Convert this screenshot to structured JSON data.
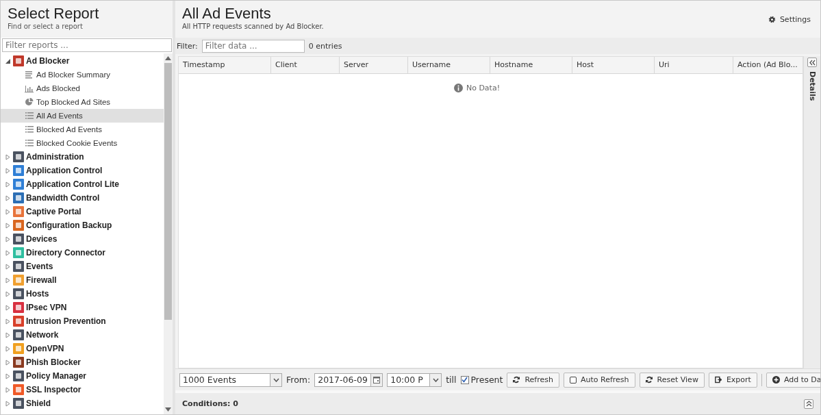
{
  "sidebar": {
    "title": "Select Report",
    "subtitle": "Find or select a report",
    "filter": {
      "placeholder": "Filter reports ..."
    },
    "items": [
      {
        "label": "Ad Blocker",
        "expanded": true,
        "color": "#c0392b",
        "children": [
          {
            "label": "Ad Blocker Summary",
            "kind": "summary",
            "selected": false
          },
          {
            "label": "Ads Blocked",
            "kind": "bar",
            "selected": false
          },
          {
            "label": "Top Blocked Ad Sites",
            "kind": "pie",
            "selected": false
          },
          {
            "label": "All Ad Events",
            "kind": "list",
            "selected": true
          },
          {
            "label": "Blocked Ad Events",
            "kind": "list",
            "selected": false
          },
          {
            "label": "Blocked Cookie Events",
            "kind": "list",
            "selected": false
          }
        ]
      },
      {
        "label": "Administration",
        "expanded": false,
        "color": "#4a5260"
      },
      {
        "label": "Application Control",
        "expanded": false,
        "color": "#2f7fd6"
      },
      {
        "label": "Application Control Lite",
        "expanded": false,
        "color": "#2f7fd6"
      },
      {
        "label": "Bandwidth Control",
        "expanded": false,
        "color": "#2c6fb5"
      },
      {
        "label": "Captive Portal",
        "expanded": false,
        "color": "#e8743b"
      },
      {
        "label": "Configuration Backup",
        "expanded": false,
        "color": "#d9661f"
      },
      {
        "label": "Devices",
        "expanded": false,
        "color": "#4a5260"
      },
      {
        "label": "Directory Connector",
        "expanded": false,
        "color": "#2fbfa0"
      },
      {
        "label": "Events",
        "expanded": false,
        "color": "#4a5260"
      },
      {
        "label": "Firewall",
        "expanded": false,
        "color": "#f0a030"
      },
      {
        "label": "Hosts",
        "expanded": false,
        "color": "#4a5260"
      },
      {
        "label": "IPsec VPN",
        "expanded": false,
        "color": "#d83040"
      },
      {
        "label": "Intrusion Prevention",
        "expanded": false,
        "color": "#d8402a"
      },
      {
        "label": "Network",
        "expanded": false,
        "color": "#4a5260"
      },
      {
        "label": "OpenVPN",
        "expanded": false,
        "color": "#f0a020"
      },
      {
        "label": "Phish Blocker",
        "expanded": false,
        "color": "#8a3a20"
      },
      {
        "label": "Policy Manager",
        "expanded": false,
        "color": "#4a5260"
      },
      {
        "label": "SSL Inspector",
        "expanded": false,
        "color": "#f05a28"
      },
      {
        "label": "Shield",
        "expanded": false,
        "color": "#4a5260"
      }
    ]
  },
  "report": {
    "title": "All Ad Events",
    "subtitle": "All HTTP requests scanned by Ad Blocker.",
    "settings": "Settings",
    "filter": {
      "label": "Filter:",
      "placeholder": "Filter data ..."
    },
    "count": "0 entries",
    "columns": [
      "Timestamp",
      "Client",
      "Server",
      "Username",
      "Hostname",
      "Host",
      "Uri",
      "Action (Ad Blo..."
    ],
    "empty": "No Data!",
    "details": "Details"
  },
  "toolbar": {
    "limit": "1000 Events",
    "from_label": "From:",
    "date": "2017-06-09",
    "time": "10:00 P",
    "till": "till",
    "present": {
      "label": "Present",
      "checked": true
    },
    "buttons": [
      {
        "label": "Refresh",
        "kind": "refresh"
      },
      {
        "label": "Auto Refresh",
        "kind": "checkbox",
        "checked": false
      },
      {
        "label": "Reset View",
        "kind": "refresh"
      },
      {
        "label": "Export",
        "kind": "export"
      },
      {
        "label": "Add to Da",
        "kind": "add"
      }
    ]
  },
  "conditions": "Conditions: 0"
}
